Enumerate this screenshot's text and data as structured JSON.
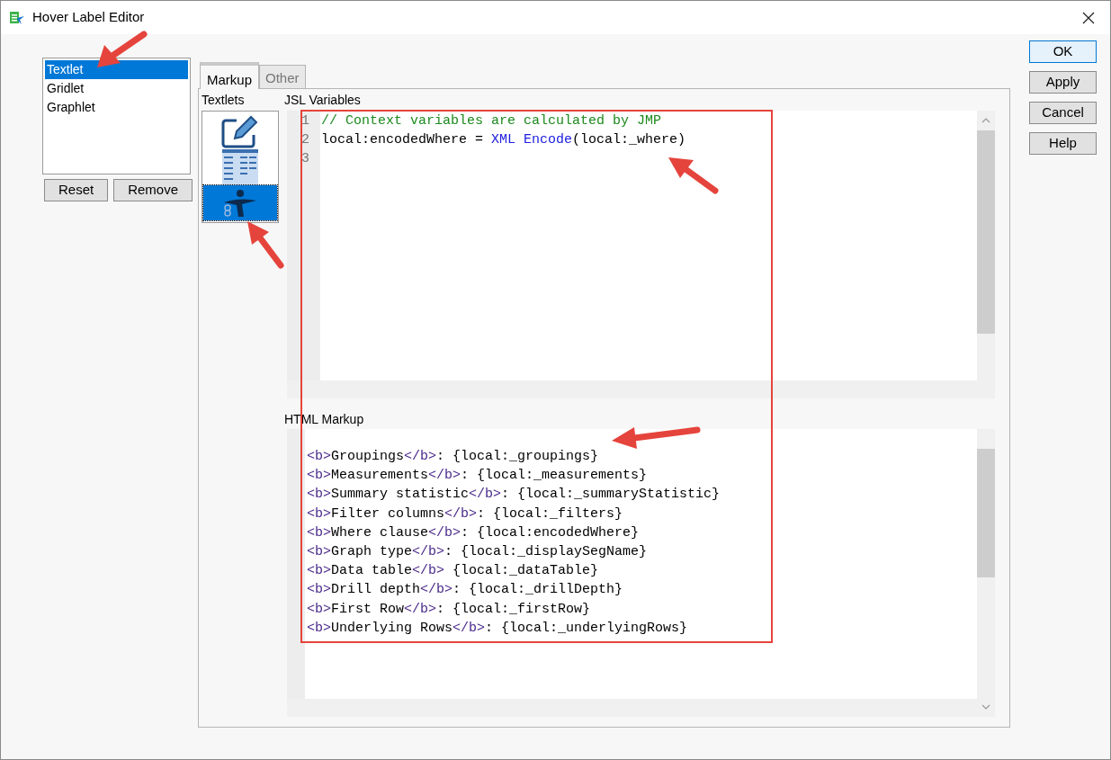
{
  "window": {
    "title": "Hover Label Editor"
  },
  "graphlet_types": [
    {
      "label": "Textlet",
      "selected": true
    },
    {
      "label": "Gridlet",
      "selected": false
    },
    {
      "label": "Graphlet",
      "selected": false
    }
  ],
  "list_buttons": [
    "Reset",
    "Remove"
  ],
  "tabs": [
    {
      "label": "Markup",
      "selected": true
    },
    {
      "label": "Other",
      "selected": false
    }
  ],
  "textlets": {
    "label": "Textlets",
    "items": [
      {
        "kind": "pencil",
        "selected": false
      },
      {
        "kind": "table",
        "selected": false
      },
      {
        "kind": "figure",
        "selected": true
      }
    ]
  },
  "jsl_variables": {
    "label": "JSL Variables",
    "lines": [
      {
        "number": "1",
        "tokens": [
          {
            "kind": "comment",
            "text": "// Context variables are calculated by JMP"
          }
        ]
      },
      {
        "number": "2",
        "tokens": [
          {
            "kind": "plain",
            "text": "local:encodedWhere = "
          },
          {
            "kind": "keyword",
            "text": "XML Encode"
          },
          {
            "kind": "plain",
            "text": "(local:_where)"
          }
        ]
      },
      {
        "number": "3"
      }
    ]
  },
  "html_markup": {
    "label": "HTML Markup",
    "lines": [
      [
        {
          "kind": "tag",
          "text": "<b>"
        },
        {
          "kind": "plain",
          "text": "Groupings"
        },
        {
          "kind": "tag",
          "text": "</b>"
        },
        {
          "kind": "plain",
          "text": ": {local:_groupings}"
        }
      ],
      [
        {
          "kind": "tag",
          "text": "<b>"
        },
        {
          "kind": "plain",
          "text": "Measurements"
        },
        {
          "kind": "tag",
          "text": "</b>"
        },
        {
          "kind": "plain",
          "text": ": {local:_measurements}"
        }
      ],
      [
        {
          "kind": "tag",
          "text": "<b>"
        },
        {
          "kind": "plain",
          "text": "Summary statistic"
        },
        {
          "kind": "tag",
          "text": "</b>"
        },
        {
          "kind": "plain",
          "text": ": {local:_summaryStatistic}"
        }
      ],
      [
        {
          "kind": "tag",
          "text": "<b>"
        },
        {
          "kind": "plain",
          "text": "Filter columns"
        },
        {
          "kind": "tag",
          "text": "</b>"
        },
        {
          "kind": "plain",
          "text": ": {local:_filters}"
        }
      ],
      [
        {
          "kind": "tag",
          "text": "<b>"
        },
        {
          "kind": "plain",
          "text": "Where clause"
        },
        {
          "kind": "tag",
          "text": "</b>"
        },
        {
          "kind": "plain",
          "text": ": {local:encodedWhere}"
        }
      ],
      [
        {
          "kind": "tag",
          "text": "<b>"
        },
        {
          "kind": "plain",
          "text": "Graph type"
        },
        {
          "kind": "tag",
          "text": "</b>"
        },
        {
          "kind": "plain",
          "text": ": {local:_displaySegName}"
        }
      ],
      [
        {
          "kind": "tag",
          "text": "<b>"
        },
        {
          "kind": "plain",
          "text": "Data table"
        },
        {
          "kind": "tag",
          "text": "</b>"
        },
        {
          "kind": "plain",
          "text": " {local:_dataTable}"
        }
      ],
      [
        {
          "kind": "tag",
          "text": "<b>"
        },
        {
          "kind": "plain",
          "text": "Drill depth"
        },
        {
          "kind": "tag",
          "text": "</b>"
        },
        {
          "kind": "plain",
          "text": ": {local:_drillDepth}"
        }
      ],
      [
        {
          "kind": "tag",
          "text": "<b>"
        },
        {
          "kind": "plain",
          "text": "First Row"
        },
        {
          "kind": "tag",
          "text": "</b>"
        },
        {
          "kind": "plain",
          "text": ": {local:_firstRow}"
        }
      ],
      [
        {
          "kind": "tag",
          "text": "<b>"
        },
        {
          "kind": "plain",
          "text": "Underlying Rows"
        },
        {
          "kind": "tag",
          "text": "</b>"
        },
        {
          "kind": "plain",
          "text": ": {local:_underlyingRows}"
        }
      ]
    ]
  },
  "dialog_buttons": [
    {
      "label": "OK",
      "default": true
    },
    {
      "label": "Apply",
      "default": false
    },
    {
      "label": "Cancel",
      "default": false
    },
    {
      "label": "Help",
      "default": false
    }
  ]
}
